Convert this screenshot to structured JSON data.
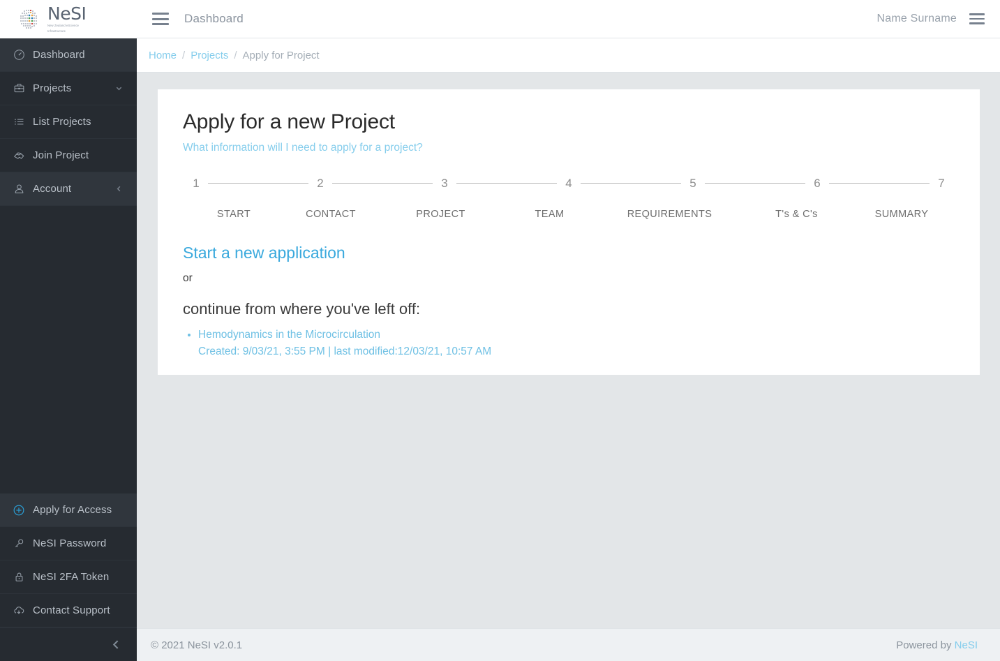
{
  "brand": {
    "name": "NeSI",
    "tagline_line1": "New Zealand eScience",
    "tagline_line2": "Infrastructure"
  },
  "header": {
    "menu_icon": "hamburger-icon",
    "title": "Dashboard",
    "user_name": "Name Surname",
    "user_menu_icon": "hamburger-icon"
  },
  "breadcrumb": {
    "items": [
      {
        "label": "Home",
        "link": true
      },
      {
        "label": "Projects",
        "link": true
      },
      {
        "label": "Apply for Project",
        "link": false
      }
    ],
    "separator": "/"
  },
  "sidebar": {
    "top_items": [
      {
        "label": "Dashboard",
        "icon": "speedometer-icon",
        "active": true,
        "caret": ""
      },
      {
        "label": "Projects",
        "icon": "briefcase-icon",
        "active": false,
        "caret": "chevron-down-icon"
      },
      {
        "label": "List Projects",
        "icon": "list-icon",
        "active": false,
        "caret": ""
      },
      {
        "label": "Join Project",
        "icon": "handshake-icon",
        "active": false,
        "caret": ""
      },
      {
        "label": "Account",
        "icon": "user-icon",
        "active": true,
        "caret": "chevron-left-icon"
      }
    ],
    "bottom_items": [
      {
        "label": "Apply for Access",
        "icon": "plus-circle-icon",
        "active": true,
        "accent": true
      },
      {
        "label": "NeSI Password",
        "icon": "key-icon",
        "active": false,
        "accent": false
      },
      {
        "label": "NeSI 2FA Token",
        "icon": "lock-icon",
        "active": false,
        "accent": false
      },
      {
        "label": "Contact Support",
        "icon": "cloud-download-icon",
        "active": false,
        "accent": false
      }
    ],
    "collapse_icon": "chevron-left-icon"
  },
  "main": {
    "title": "Apply for a new Project",
    "info_link": "What information will I need to apply for a project?",
    "stepper": [
      {
        "number": "1",
        "label": "START"
      },
      {
        "number": "2",
        "label": "CONTACT"
      },
      {
        "number": "3",
        "label": "PROJECT"
      },
      {
        "number": "4",
        "label": "TEAM"
      },
      {
        "number": "5",
        "label": "REQUIREMENTS"
      },
      {
        "number": "6",
        "label": "T's & C's"
      },
      {
        "number": "7",
        "label": "SUMMARY"
      }
    ],
    "start_link": "Start a new application",
    "or_text": "or",
    "continue_text": "continue from where you've left off:",
    "drafts": [
      {
        "title": "Hemodynamics in the Microcirculation",
        "meta": "Created: 9/03/21, 3:55 PM | last modified:12/03/21, 10:57 AM"
      }
    ]
  },
  "footer": {
    "copyright": "© 2021 NeSI v2.0.1",
    "powered_prefix": "Powered by ",
    "powered_link": "NeSI"
  },
  "colors": {
    "sidebar_bg": "#262b31",
    "sidebar_active": "#30363d",
    "link_blue": "#85cdec",
    "accent_blue": "#3aa9dd",
    "page_bg": "#e3e6e8",
    "card_bg": "#ffffff"
  }
}
